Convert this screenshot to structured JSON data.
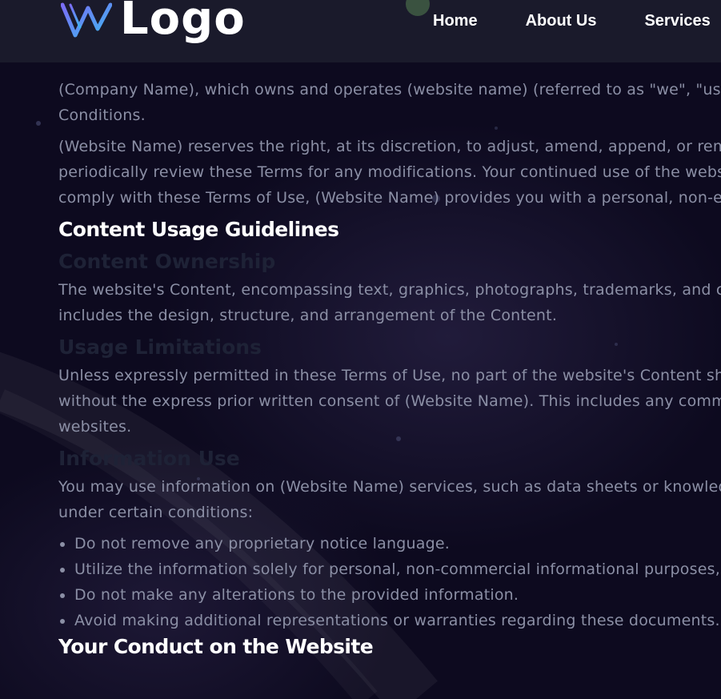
{
  "header": {
    "logo_text": "Logo",
    "nav": [
      "Home",
      "About Us",
      "Services"
    ]
  },
  "content": {
    "intro_p1": [
      "(Company Name), which owns and operates (website name) (referred to as \"we\", \"us\",",
      "Conditions."
    ],
    "intro_p2": [
      "(Website Name) reserves the right, at its discretion, to adjust, amend, append, or rem",
      "periodically review these Terms for any modifications. Your continued use of the webs",
      "comply with these Terms of Use, (Website Name) provides you with a personal, non-ex"
    ],
    "section1_title": "Content Usage Guidelines",
    "sub1_title": "Content Ownership",
    "sub1_p": [
      "The website's Content, encompassing text, graphics, photographs, trademarks, and co",
      "includes the design, structure, and arrangement of the Content."
    ],
    "sub2_title": "Usage Limitations",
    "sub2_p": [
      "Unless expressly permitted in these Terms of Use, no part of the website's Content sho",
      "without the express prior written consent of (Website Name). This includes any comme",
      "websites."
    ],
    "sub3_title": "Information Use",
    "sub3_p": [
      "You may use information on (Website Name) services, such as data sheets or knowled",
      "under certain conditions:"
    ],
    "bullets": [
      "Do not remove any proprietary notice language.",
      "Utilize the information solely for personal, non-commercial informational purposes,",
      "Do not make any alterations to the provided information.",
      "Avoid making additional representations or warranties regarding these documents."
    ],
    "section2_title": "Your Conduct on the Website"
  },
  "icons": {
    "logo_mark": "logo-mark-icon",
    "bullet": "bullet-icon"
  },
  "colors": {
    "background": "#0d0a1f",
    "header_bg": "#1a1a2b",
    "body_text": "#8b8fa5",
    "heading_text": "#ffffff",
    "subheading_text": "#1e2236",
    "logo_gradient_start": "#7b6cf6",
    "logo_gradient_end": "#3fb5f0"
  }
}
